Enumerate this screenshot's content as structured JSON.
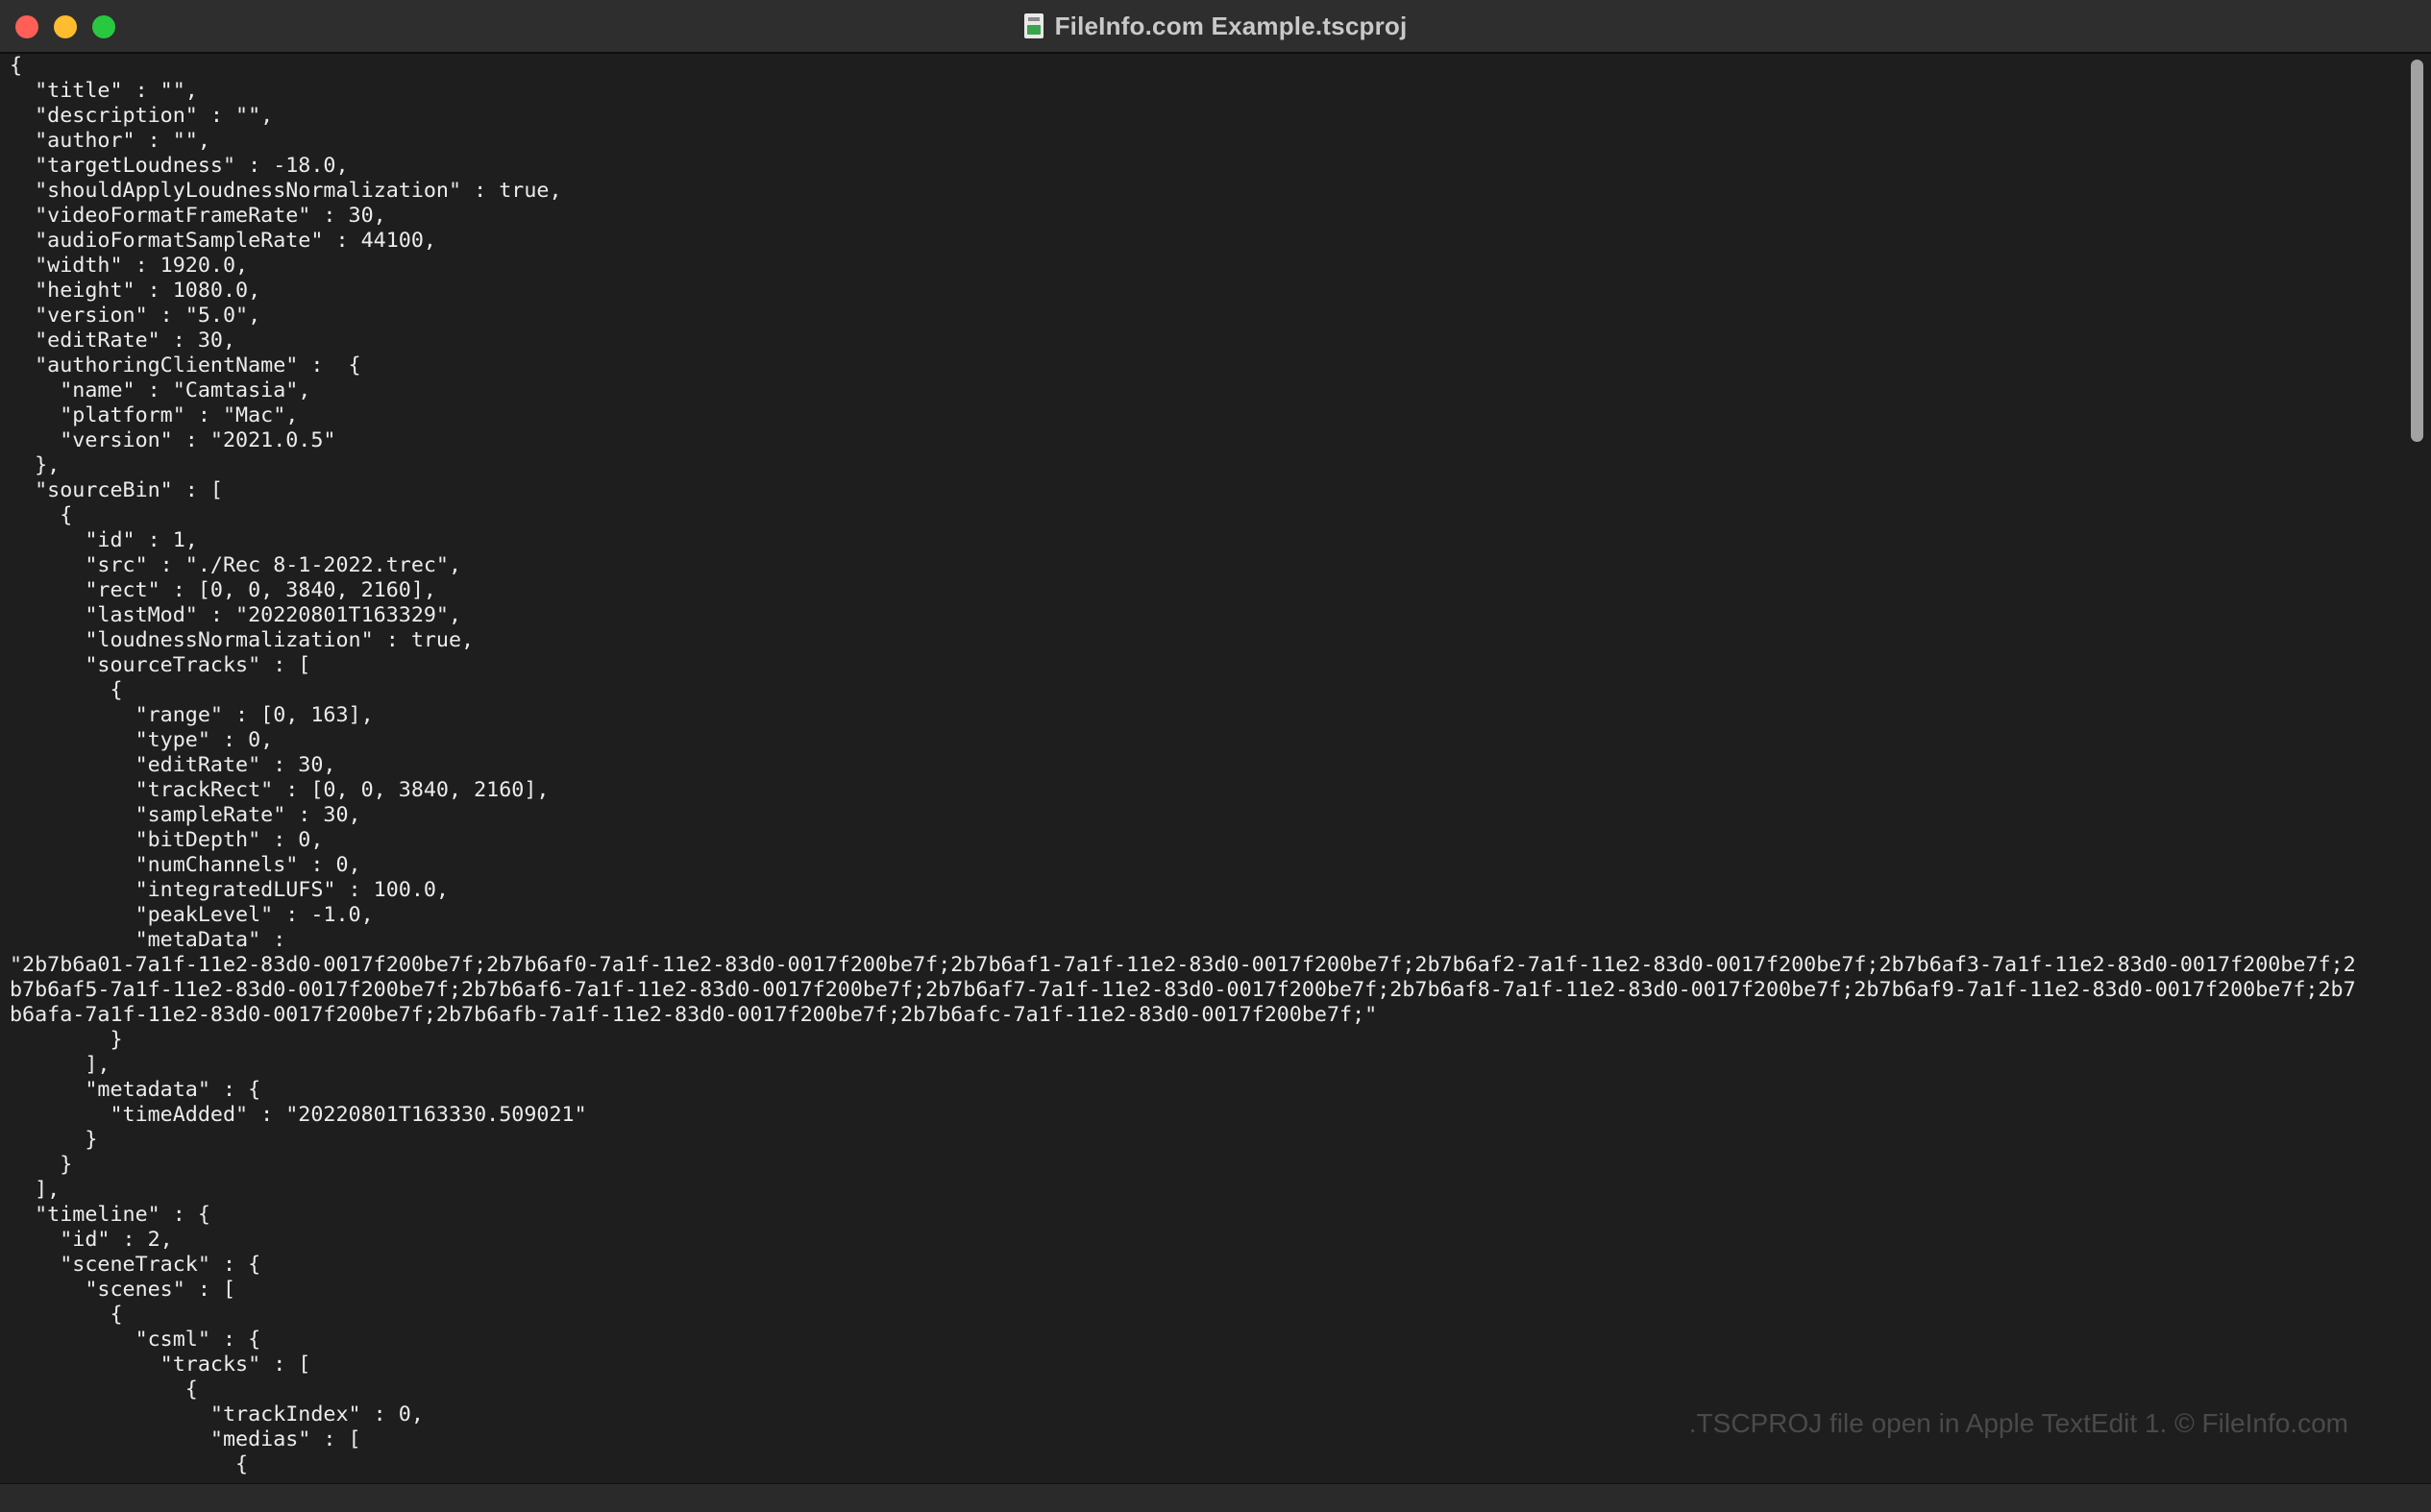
{
  "window": {
    "title": "FileInfo.com Example.tscproj",
    "icon": "document-icon"
  },
  "editor": {
    "lines": [
      "{",
      "  \"title\" : \"\",",
      "  \"description\" : \"\",",
      "  \"author\" : \"\",",
      "  \"targetLoudness\" : -18.0,",
      "  \"shouldApplyLoudnessNormalization\" : true,",
      "  \"videoFormatFrameRate\" : 30,",
      "  \"audioFormatSampleRate\" : 44100,",
      "  \"width\" : 1920.0,",
      "  \"height\" : 1080.0,",
      "  \"version\" : \"5.0\",",
      "  \"editRate\" : 30,",
      "  \"authoringClientName\" :  {",
      "    \"name\" : \"Camtasia\",",
      "    \"platform\" : \"Mac\",",
      "    \"version\" : \"2021.0.5\"",
      "  },",
      "  \"sourceBin\" : [",
      "    {",
      "      \"id\" : 1,",
      "      \"src\" : \"./Rec 8-1-2022.trec\",",
      "      \"rect\" : [0, 0, 3840, 2160],",
      "      \"lastMod\" : \"20220801T163329\",",
      "      \"loudnessNormalization\" : true,",
      "      \"sourceTracks\" : [",
      "        {",
      "          \"range\" : [0, 163],",
      "          \"type\" : 0,",
      "          \"editRate\" : 30,",
      "          \"trackRect\" : [0, 0, 3840, 2160],",
      "          \"sampleRate\" : 30,",
      "          \"bitDepth\" : 0,",
      "          \"numChannels\" : 0,",
      "          \"integratedLUFS\" : 100.0,",
      "          \"peakLevel\" : -1.0,",
      "          \"metaData\" :",
      "\"2b7b6a01-7a1f-11e2-83d0-0017f200be7f;2b7b6af0-7a1f-11e2-83d0-0017f200be7f;2b7b6af1-7a1f-11e2-83d0-0017f200be7f;2b7b6af2-7a1f-11e2-83d0-0017f200be7f;2b7b6af3-7a1f-11e2-83d0-0017f200be7f;2",
      "b7b6af5-7a1f-11e2-83d0-0017f200be7f;2b7b6af6-7a1f-11e2-83d0-0017f200be7f;2b7b6af7-7a1f-11e2-83d0-0017f200be7f;2b7b6af8-7a1f-11e2-83d0-0017f200be7f;2b7b6af9-7a1f-11e2-83d0-0017f200be7f;2b7",
      "b6afa-7a1f-11e2-83d0-0017f200be7f;2b7b6afb-7a1f-11e2-83d0-0017f200be7f;2b7b6afc-7a1f-11e2-83d0-0017f200be7f;\"",
      "        }",
      "      ],",
      "      \"metadata\" : {",
      "        \"timeAdded\" : \"20220801T163330.509021\"",
      "      }",
      "    }",
      "  ],",
      "  \"timeline\" : {",
      "    \"id\" : 2,",
      "    \"sceneTrack\" : {",
      "      \"scenes\" : [",
      "        {",
      "          \"csml\" : {",
      "            \"tracks\" : [",
      "              {",
      "                \"trackIndex\" : 0,",
      "                \"medias\" : [",
      "                  {"
    ]
  },
  "watermark": ".TSCPROJ file open in Apple TextEdit 1. © FileInfo.com",
  "colors": {
    "background": "#1e1e1e",
    "titlebar": "#2e2e2e",
    "text": "#ececec",
    "close": "#ff5f57",
    "minimize": "#febc2e",
    "zoom": "#28c840"
  }
}
